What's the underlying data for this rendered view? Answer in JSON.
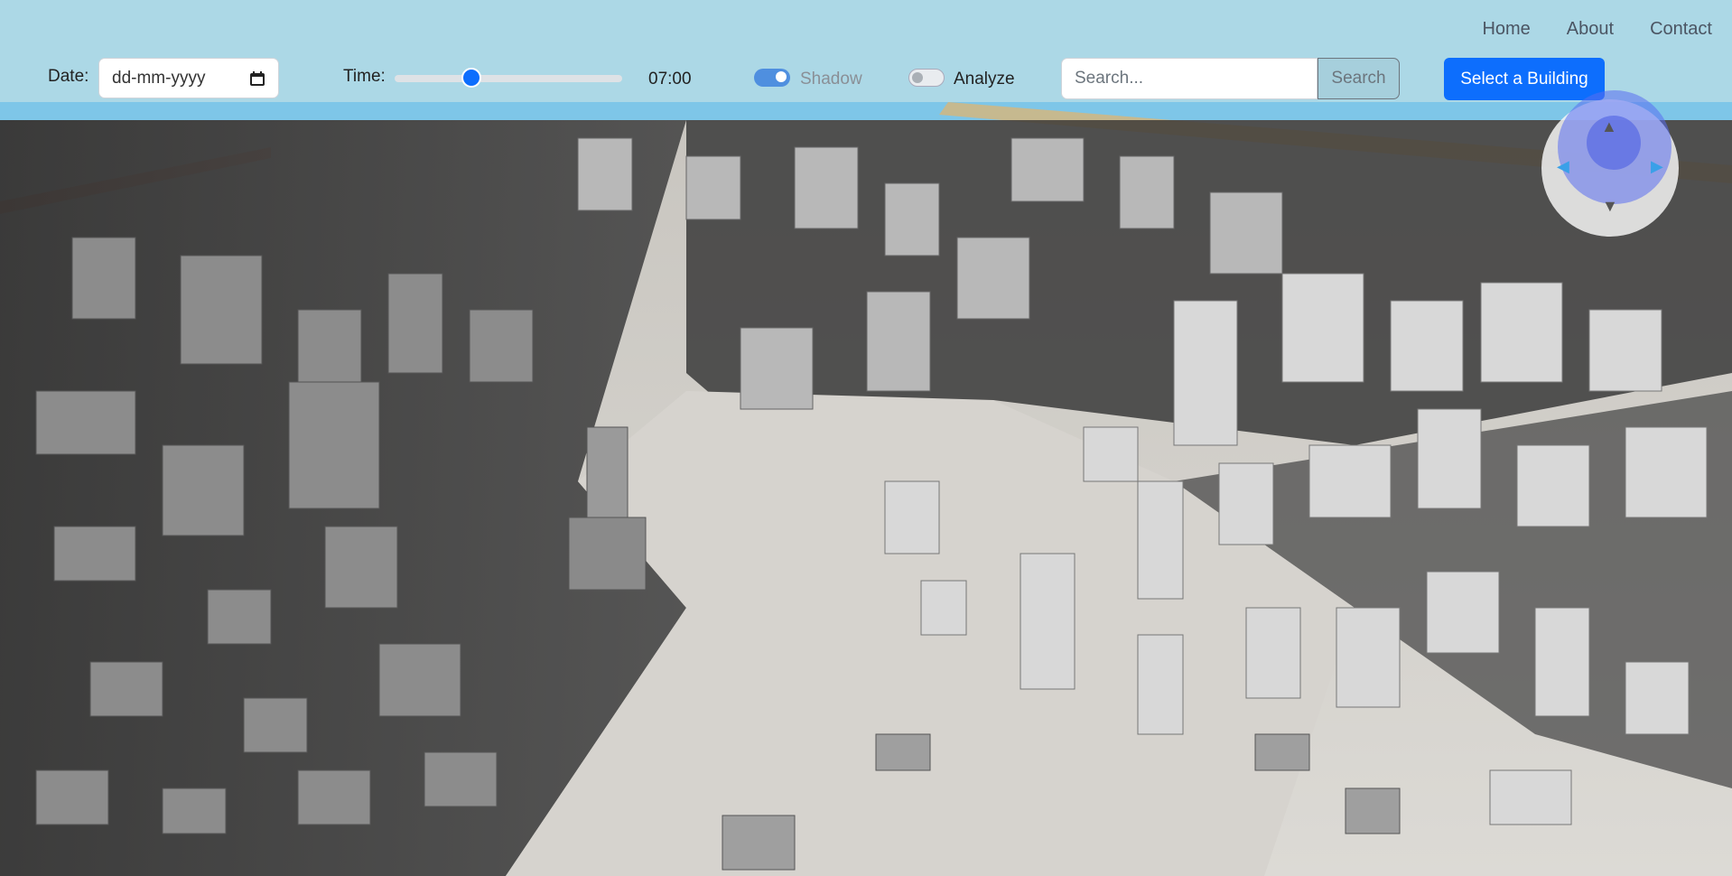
{
  "nav": {
    "home": "Home",
    "about": "About",
    "contact": "Contact"
  },
  "controls": {
    "date_label": "Date:",
    "date_placeholder": "dd-mm-yyyy",
    "time_label": "Time:",
    "time_value": "07:00",
    "time_slider_fraction": 0.32,
    "shadow_label": "Shadow",
    "shadow_on": true,
    "analyze_label": "Analyze",
    "analyze_on": false,
    "search_placeholder": "Search...",
    "search_button": "Search",
    "select_building_button": "Select a Building"
  },
  "icons": {
    "date_picker": "calendar-icon",
    "compass_up": "arrow-up-icon",
    "compass_down": "arrow-down-icon",
    "compass_left": "arrow-left-icon",
    "compass_right": "arrow-right-icon"
  },
  "colors": {
    "header_bg": "#acd8e6",
    "accent": "#0d6efd",
    "map_ground": "#d9d6d1",
    "sky": "#7ec6e8",
    "building": "#8a8a8a"
  }
}
